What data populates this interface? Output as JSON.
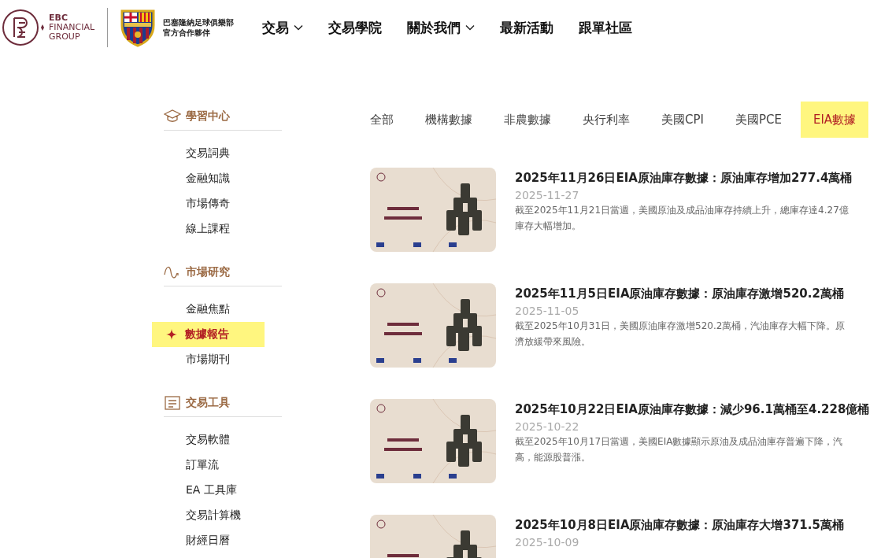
{
  "header": {
    "brand": {
      "name": "EBC",
      "line_1": "FINANCIAL",
      "line_2": "GROUP"
    },
    "partner": {
      "line_1": "巴塞隆納足球俱樂部",
      "line_2": "官方合作夥伴"
    },
    "nav": [
      {
        "label": "交易",
        "dropdown": true
      },
      {
        "label": "交易學院",
        "dropdown": false
      },
      {
        "label": "關於我們",
        "dropdown": true
      },
      {
        "label": "最新活動",
        "dropdown": false
      },
      {
        "label": "跟單社區",
        "dropdown": false
      }
    ]
  },
  "sidebar": {
    "sections": [
      {
        "kind": "cap",
        "title": "學習中心",
        "items": [
          {
            "label": "交易詞典",
            "selected": false
          },
          {
            "label": "金融知識",
            "selected": false
          },
          {
            "label": "市場傳奇",
            "selected": false
          },
          {
            "label": "線上課程",
            "selected": false
          }
        ]
      },
      {
        "kind": "wave",
        "title": "市場研究",
        "items": [
          {
            "label": "金融焦點",
            "selected": false
          },
          {
            "label": "數據報告",
            "selected": true
          },
          {
            "label": "市場期刊",
            "selected": false
          }
        ]
      },
      {
        "kind": "tool",
        "title": "交易工具",
        "items": [
          {
            "label": "交易軟體",
            "selected": false
          },
          {
            "label": "訂單流",
            "selected": false
          },
          {
            "label": "EA 工具庫",
            "selected": false
          },
          {
            "label": "交易計算機",
            "selected": false
          },
          {
            "label": "財經日曆",
            "selected": false
          }
        ]
      }
    ]
  },
  "tabs": [
    {
      "label": "全部",
      "selected": false
    },
    {
      "label": "機構數據",
      "selected": false
    },
    {
      "label": "非農數據",
      "selected": false
    },
    {
      "label": "央行利率",
      "selected": false
    },
    {
      "label": "美國CPI",
      "selected": false
    },
    {
      "label": "美國PCE",
      "selected": false
    },
    {
      "label": "EIA數據",
      "selected": true
    }
  ],
  "articles": [
    {
      "title": "2025年11月26日EIA原油庫存數據：原油庫存增加277.4萬桶",
      "date": "2025-11-27",
      "summary_lines": [
        "截至2025年11月21日當週，美國原油及成品油庫存持續上升，總庫存達4.27億",
        "庫存大幅增加。"
      ]
    },
    {
      "title": "2025年11月5日EIA原油庫存數據：原油庫存激增520.2萬桶",
      "date": "2025-11-05",
      "summary_lines": [
        "截至2025年10月31日，美國原油庫存激增520.2萬桶，汽油庫存大幅下降。原",
        "濟放緩帶來風險。"
      ]
    },
    {
      "title": "2025年10月22日EIA原油庫存數據：減少96.1萬桶至4.228億桶",
      "date": "2025-10-22",
      "summary_lines": [
        "截至2025年10月17日當週，美國EIA數據顯示原油及成品油庫存普遍下降，汽",
        "高，能源股普漲。"
      ]
    },
    {
      "title": "2025年10月8日EIA原油庫存數據：原油庫存大增371.5萬桶",
      "date": "2025-10-09"
    }
  ]
}
